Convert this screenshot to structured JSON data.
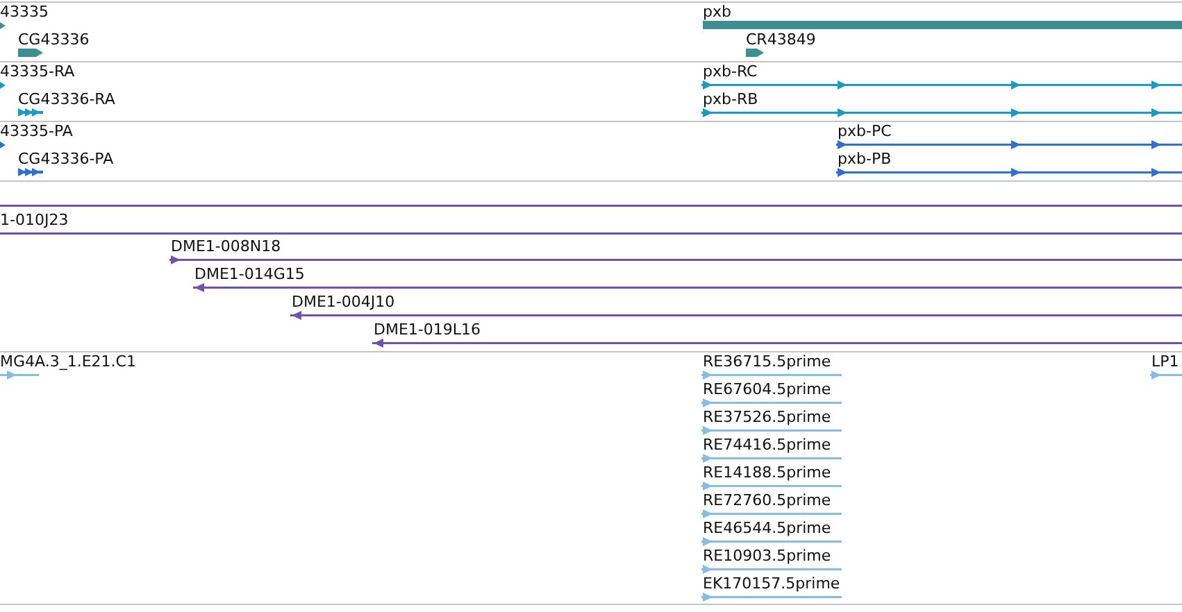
{
  "tracks": [
    {
      "color": "#3d8e8e",
      "features": [
        {
          "label": "43335",
          "kind": "stub",
          "reverse": false
        },
        {
          "label": "CG43336",
          "kind": "block",
          "reverse": false
        },
        {
          "label": "pxb",
          "kind": "bar"
        },
        {
          "label": "CR43849",
          "kind": "block",
          "reverse": false
        }
      ]
    },
    {
      "color": "#1a9bc4",
      "features": [
        {
          "label": "43335-RA",
          "kind": "stub",
          "reverse": false
        },
        {
          "label": "CG43336-RA",
          "kind": "exons",
          "reverse": false
        },
        {
          "label": "pxb-RC",
          "kind": "line",
          "reverse": false
        },
        {
          "label": "pxb-RB",
          "kind": "line",
          "reverse": false
        }
      ]
    },
    {
      "color": "#2e6fd4",
      "features": [
        {
          "label": "43335-PA",
          "kind": "stub",
          "reverse": false
        },
        {
          "label": "CG43336-PA",
          "kind": "exons",
          "reverse": false
        },
        {
          "label": "pxb-PC",
          "kind": "line",
          "reverse": false
        },
        {
          "label": "pxb-PB",
          "kind": "line",
          "reverse": false
        }
      ]
    },
    {
      "color": "#7050b0",
      "features": [
        {
          "kind": "line"
        },
        {
          "label": "1-010J23",
          "kind": "line"
        },
        {
          "label": "DME1-008N18",
          "kind": "line",
          "reverse": false
        },
        {
          "label": "DME1-014G15",
          "kind": "line",
          "reverse": true
        },
        {
          "label": "DME1-004J10",
          "kind": "line",
          "reverse": true
        },
        {
          "label": "DME1-019L16",
          "kind": "line",
          "reverse": true
        }
      ]
    },
    {
      "color": "#88bde3",
      "features": [
        {
          "label": "MG4A.3_1.E21.C1",
          "kind": "line",
          "reverse": false
        },
        {
          "label": "RE36715.5prime",
          "kind": "line",
          "reverse": false
        },
        {
          "label": "RE67604.5prime",
          "kind": "line",
          "reverse": false
        },
        {
          "label": "RE37526.5prime",
          "kind": "line",
          "reverse": false
        },
        {
          "label": "RE74416.5prime",
          "kind": "line",
          "reverse": false
        },
        {
          "label": "RE14188.5prime",
          "kind": "line",
          "reverse": false
        },
        {
          "label": "RE72760.5prime",
          "kind": "line",
          "reverse": false
        },
        {
          "label": "RE46544.5prime",
          "kind": "line",
          "reverse": false
        },
        {
          "label": "RE10903.5prime",
          "kind": "line",
          "reverse": false
        },
        {
          "label": "EK170157.5prime",
          "kind": "line",
          "reverse": false
        },
        {
          "label": "LP1",
          "kind": "line",
          "reverse": false
        }
      ]
    }
  ]
}
